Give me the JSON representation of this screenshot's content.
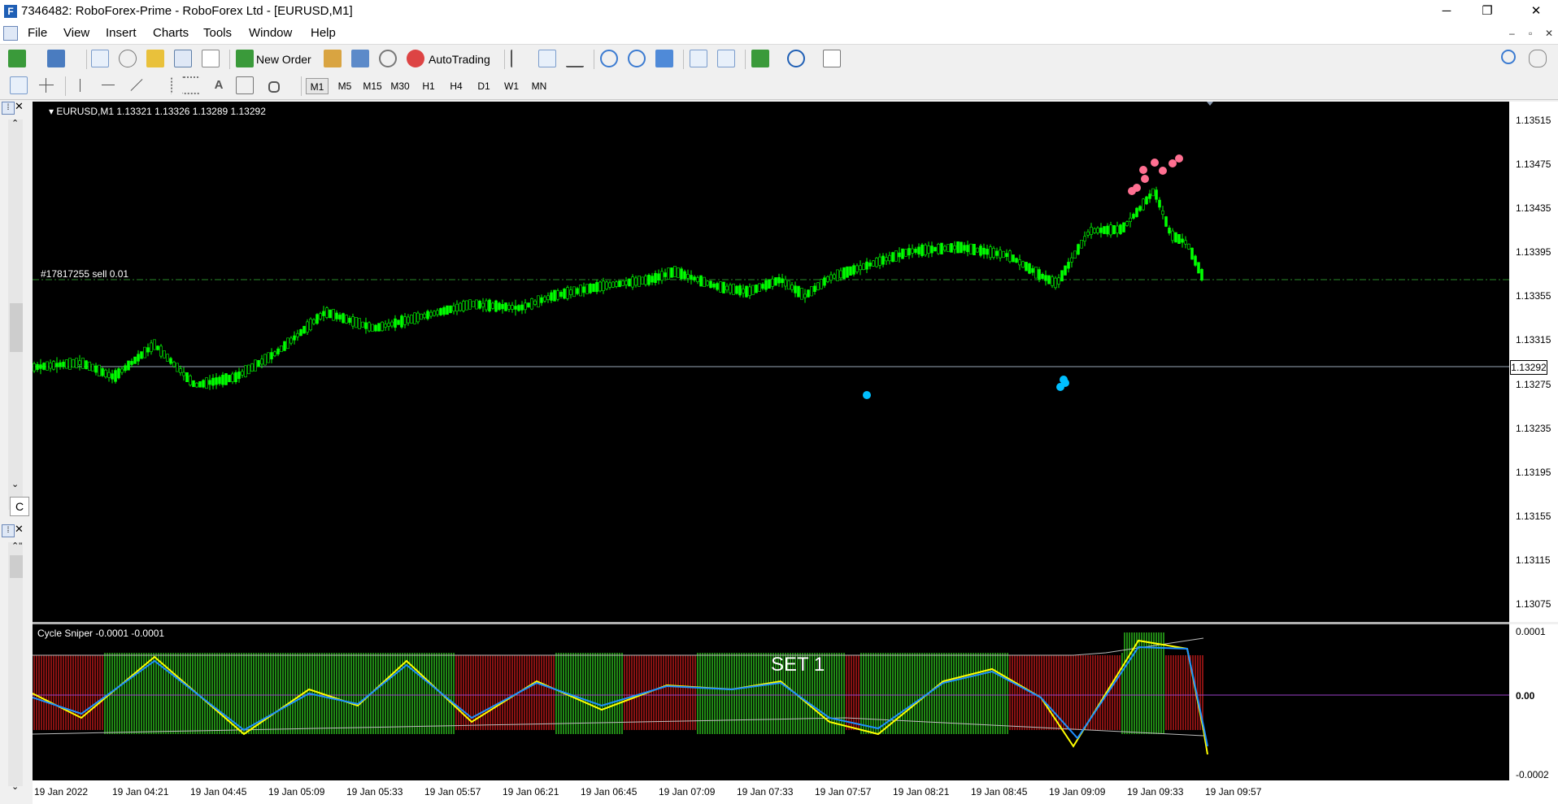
{
  "window": {
    "title": "7346482: RoboForex-Prime - RoboForex Ltd - [EURUSD,M1]",
    "icon": "mt4-app-icon"
  },
  "menu": [
    "File",
    "View",
    "Insert",
    "Charts",
    "Tools",
    "Window",
    "Help"
  ],
  "toolbar": {
    "new_order_label": "New Order",
    "autotrading_label": "AutoTrading",
    "timeframes": [
      "M1",
      "M5",
      "M15",
      "M30",
      "H1",
      "H4",
      "D1",
      "W1",
      "MN"
    ],
    "active_timeframe": "M1"
  },
  "chart": {
    "header": "EURUSD,M1  1.13321 1.13326 1.13289 1.13292",
    "order_line_label": "#17817255 sell 0.01",
    "current_price": "1.13292",
    "price_ticks": [
      "1.13515",
      "1.13475",
      "1.13435",
      "1.13395",
      "1.13355",
      "1.13315",
      "1.13275",
      "1.13235",
      "1.13195",
      "1.13155",
      "1.13115",
      "1.13075"
    ],
    "time_ticks": [
      "19 Jan 2022",
      "19 Jan 04:21",
      "19 Jan 04:45",
      "19 Jan 05:09",
      "19 Jan 05:33",
      "19 Jan 05:57",
      "19 Jan 06:21",
      "19 Jan 06:45",
      "19 Jan 07:09",
      "19 Jan 07:33",
      "19 Jan 07:57",
      "19 Jan 08:21",
      "19 Jan 08:45",
      "19 Jan 09:09",
      "19 Jan 09:33",
      "19 Jan 09:57"
    ],
    "candle_color": "#00ff00",
    "buy_marker_color": "#00bfff",
    "sell_marker_color": "#ff6f91"
  },
  "indicator": {
    "header": "Cycle Sniper -0.0001 -0.0001",
    "set_label": "SET 1",
    "ticks": [
      "0.0001",
      "0.00",
      "-0.0002"
    ],
    "green_color": "#2ec21e",
    "red_color": "#c21a1a",
    "fast_line_color": "#ffff00",
    "slow_line_color": "#1e90ff"
  },
  "side_panel": {
    "tab_letter": "C"
  }
}
